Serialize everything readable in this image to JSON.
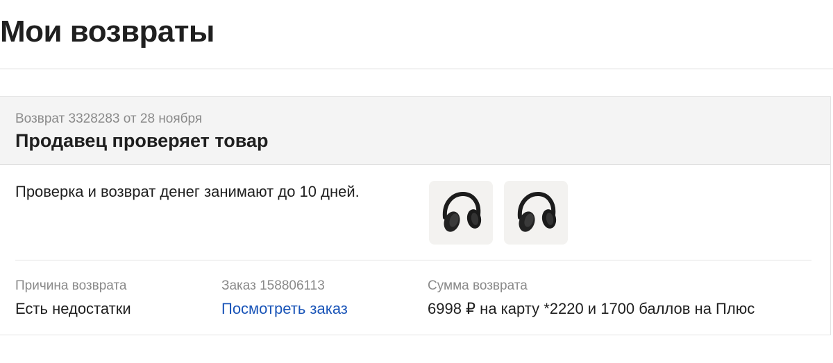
{
  "page": {
    "title": "Мои возвраты"
  },
  "return": {
    "meta": "Возврат 3328283 от 28 ноября",
    "status": "Продавец проверяет товар",
    "info": "Проверка и возврат денег занимают до 10 дней.",
    "items": [
      {
        "icon": "headphones-icon"
      },
      {
        "icon": "headphones-icon"
      }
    ],
    "reason": {
      "label": "Причина возврата",
      "value": "Есть недостатки"
    },
    "order": {
      "label": "Заказ 158806113",
      "link": "Посмотреть заказ"
    },
    "amount": {
      "label": "Сумма возврата",
      "value": "6998 ₽ на карту *2220 и 1700 баллов на Плюс"
    }
  },
  "colors": {
    "link": "#1a55b8",
    "header_bg": "#f4f4f4",
    "muted_text": "#8a8a8a"
  }
}
